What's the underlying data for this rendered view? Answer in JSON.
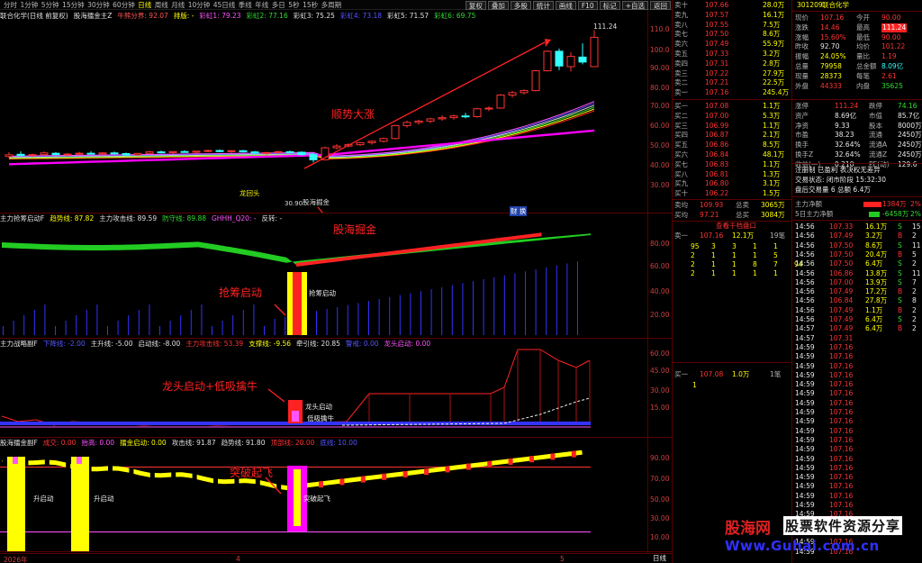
{
  "toolbar": {
    "periods": [
      "分时",
      "1分钟",
      "5分钟",
      "15分钟",
      "30分钟",
      "60分钟",
      "日线",
      "周线",
      "月线",
      "10分钟",
      "45日线",
      "季线",
      "年线",
      "多日",
      "5秒",
      "15秒",
      "多周期"
    ],
    "active_period": "日线",
    "right_buttons": [
      "复权",
      "叠加",
      "多股",
      "统计",
      "画线",
      "F10",
      "标记",
      "+自选",
      "返回"
    ]
  },
  "main_pane": {
    "header": [
      {
        "text": "联合化学(日线 前复权)",
        "color": "#e0e0e0"
      },
      {
        "text": "股海擂金主Z",
        "color": "#e0e0e0"
      },
      {
        "text": "牛熊分界: 92.07",
        "color": "#ff5555"
      },
      {
        "text": "排版: -",
        "color": "#ffff00"
      },
      {
        "text": "彩虹1: 79.23",
        "color": "#ff55ff"
      },
      {
        "text": "彩虹2: 77.16",
        "color": "#33dd33"
      },
      {
        "text": "彩虹3: 75.25",
        "color": "#e0e0e0"
      },
      {
        "text": "彩虹4: 73.18",
        "color": "#5555ff"
      },
      {
        "text": "彩虹5: 71.57",
        "color": "#e0e0e0"
      },
      {
        "text": "彩虹6: 69.75",
        "color": "#33dd33"
      }
    ],
    "axis": [
      "110.0",
      "100.0",
      "90.00",
      "80.00",
      "70.00",
      "60.00",
      "50.00",
      "40.00",
      "30.00"
    ],
    "annotations": {
      "trend": "顺势大涨",
      "gold": "股海掘金",
      "high_label": "111.24",
      "low_label": "30.90",
      "candle_tag": "股海掘金",
      "dragon_tag": "龙回头",
      "bottom_tag": "财 换"
    }
  },
  "pane2": {
    "header": [
      {
        "text": "主力抢筹启动F",
        "color": "#e0e0e0"
      },
      {
        "text": "趋势线: 87.82",
        "color": "#ffff00"
      },
      {
        "text": "主力攻击线: 89.59",
        "color": "#e0e0e0"
      },
      {
        "text": "防守线: 89.88",
        "color": "#33dd33"
      },
      {
        "text": "GHHH_Q20: -",
        "color": "#ff55ff"
      },
      {
        "text": "反转: -",
        "color": "#e0e0e0"
      }
    ],
    "axis": [
      "80.00",
      "60.00",
      "40.00",
      "20.00"
    ],
    "annotations": {
      "label": "抢筹启动",
      "tag": "抢筹启动"
    }
  },
  "pane3": {
    "header": [
      {
        "text": "主力战略副F",
        "color": "#e0e0e0"
      },
      {
        "text": "下降线: -2.00",
        "color": "#5555ff"
      },
      {
        "text": "主升线: -5.00",
        "color": "#e0e0e0"
      },
      {
        "text": "启动线: -8.00",
        "color": "#e0e0e0"
      },
      {
        "text": "主力攻击线: 53.39",
        "color": "#ff3333"
      },
      {
        "text": "支撑线: -9.56",
        "color": "#ffff00"
      },
      {
        "text": "牵引线: 20.85",
        "color": "#e0e0e0"
      },
      {
        "text": "警戒: 0.00",
        "color": "#5555ff"
      },
      {
        "text": "龙头启动: 0.00",
        "color": "#ff55ff"
      }
    ],
    "axis": [
      "60.00",
      "45.00",
      "30.00",
      "15.00"
    ],
    "annotations": {
      "label": "龙头启动+低吸擒牛",
      "tag1": "龙头启动",
      "tag2": "低吸擒牛"
    }
  },
  "pane4": {
    "header": [
      {
        "text": "股海擂金副F",
        "color": "#e0e0e0"
      },
      {
        "text": "成交: 0.00",
        "color": "#ff3333"
      },
      {
        "text": "抬高: 0.00",
        "color": "#ff55ff"
      },
      {
        "text": "擂金启动: 0.00",
        "color": "#ffff00"
      },
      {
        "text": "攻击线: 91.87",
        "color": "#e0e0e0"
      },
      {
        "text": "趋势线: 91.80",
        "color": "#e0e0e0"
      },
      {
        "text": "顶部线: 20.00",
        "color": "#ff3333"
      },
      {
        "text": "底线: 10.00",
        "color": "#5555ff"
      }
    ],
    "axis": [
      "90.00",
      "70.00",
      "50.00",
      "30.00",
      "10.00"
    ],
    "annotations": {
      "label": "突破起飞",
      "tag": "突破起飞",
      "side1": "升启动",
      "side2": "升启动"
    }
  },
  "bottom": {
    "year": "2026年",
    "m1": "4",
    "m2": "5"
  },
  "quote": {
    "code": "301209",
    "name": "联合化学",
    "ask": [
      {
        "label": "卖十",
        "price": "107.66",
        "vol": "28.0万"
      },
      {
        "label": "卖九",
        "price": "107.57",
        "vol": "16.1万"
      },
      {
        "label": "卖八",
        "price": "107.55",
        "vol": "7.5万"
      },
      {
        "label": "卖七",
        "price": "107.50",
        "vol": "8.6万"
      },
      {
        "label": "卖六",
        "price": "107.49",
        "vol": "55.9万"
      },
      {
        "label": "卖五",
        "price": "107.33",
        "vol": "3.2万"
      },
      {
        "label": "卖四",
        "price": "107.31",
        "vol": "2.8万"
      },
      {
        "label": "卖三",
        "price": "107.22",
        "vol": "27.9万"
      },
      {
        "label": "卖二",
        "price": "107.21",
        "vol": "22.5万"
      },
      {
        "label": "卖一",
        "price": "107.16",
        "vol": "245.4万"
      }
    ],
    "stats": [
      {
        "k": "现价",
        "v": "107.16",
        "k2": "今开",
        "v2": "90.00"
      },
      {
        "k": "涨跌",
        "v": "14.46",
        "k2": "最高",
        "v2": "111.24"
      },
      {
        "k": "涨幅",
        "v": "15.60%",
        "k2": "最低",
        "v2": "90.00"
      },
      {
        "k": "昨收",
        "v": "92.70",
        "k2": "均价",
        "v2": "101.22"
      },
      {
        "k": "振幅",
        "v": "24.05%",
        "k2": "量比",
        "v2": "1.19"
      },
      {
        "k": "总量",
        "v": "79958",
        "k2": "总金额",
        "v2": "8.09亿"
      },
      {
        "k": "现量",
        "v": "28373",
        "k2": "每笔",
        "v2": "2.61"
      },
      {
        "k": "外盘",
        "v": "44333",
        "k2": "内盘",
        "v2": "35625"
      }
    ],
    "bid": [
      {
        "label": "买一",
        "price": "107.08",
        "vol": "1.1万"
      },
      {
        "label": "买二",
        "price": "107.00",
        "vol": "5.3万"
      },
      {
        "label": "买三",
        "price": "106.99",
        "vol": "1.1万"
      },
      {
        "label": "买四",
        "price": "106.87",
        "vol": "2.1万"
      },
      {
        "label": "买五",
        "price": "106.86",
        "vol": "8.5万"
      },
      {
        "label": "买六",
        "price": "106.84",
        "vol": "48.1万"
      },
      {
        "label": "买七",
        "price": "106.83",
        "vol": "1.1万"
      },
      {
        "label": "买八",
        "price": "106.81",
        "vol": "1.3万"
      },
      {
        "label": "买九",
        "price": "106.80",
        "vol": "3.1万"
      },
      {
        "label": "买十",
        "price": "106.22",
        "vol": "1.5万"
      }
    ],
    "avg": [
      {
        "k": "卖均",
        "v": "109.93",
        "k2": "总卖",
        "v2": "3065万"
      },
      {
        "k": "买均",
        "v": "97.21",
        "k2": "总买",
        "v2": "3084万"
      }
    ],
    "queue_link": "查看千档盘口",
    "queue_sell": {
      "label": "卖一",
      "price": "107.16",
      "vol": "12.1万",
      "cnt": "19笔"
    },
    "queue_sell_rows": [
      [
        "95",
        "3",
        "3",
        "1",
        "1"
      ],
      [
        "2",
        "1",
        "1",
        "1",
        "5"
      ],
      [
        "2",
        "1",
        "1",
        "8",
        "7",
        "94"
      ],
      [
        "2",
        "1",
        "1",
        "1",
        "1"
      ]
    ],
    "queue_buy": {
      "label": "买一",
      "price": "107.08",
      "vol": "1.0万",
      "cnt": "1笔"
    },
    "queue_buy_rows": [
      [
        "1"
      ]
    ],
    "fund": [
      {
        "k": "涨停",
        "v": "111.24",
        "k2": "跌停",
        "v2": "74.16"
      },
      {
        "k": "资产",
        "v": "8.69亿",
        "k2": "市值",
        "v2": "85.7亿"
      },
      {
        "k": "净资",
        "v": "9.33",
        "k2": "股本",
        "v2": "8000万"
      },
      {
        "k": "市盈",
        "v": "38.23",
        "k2": "流通",
        "v2": "2450万"
      },
      {
        "k": "换手",
        "v": "32.64%",
        "k2": "流通A",
        "v2": "2450万"
      },
      {
        "k": "换手Z",
        "v": "32.64%",
        "k2": "流通Z",
        "v2": "2450万"
      },
      {
        "k": "收益(一)",
        "v": "0.210",
        "k2": "PE(动)",
        "v2": "129.6"
      }
    ],
    "info1": "注册制 已盈利 表决权无差异",
    "info2": "交易状态: 闭市阶段 15:32:30",
    "info3": "盘后交易量 6 总额 6.4万",
    "net": [
      {
        "k": "主力净额",
        "v": "1384万",
        "pct": "2%"
      },
      {
        "k": "5日主力净额",
        "v": "-6458万",
        "pct": "2%"
      }
    ],
    "ticks": [
      [
        "14:56",
        "107.33",
        "16.1万",
        "S",
        "15"
      ],
      [
        "14:56",
        "107.49",
        "3.2万",
        "B",
        "2"
      ],
      [
        "14:56",
        "107.50",
        "8.6万",
        "S",
        "11"
      ],
      [
        "14:56",
        "107.50",
        "20.4万",
        "B",
        "5"
      ],
      [
        "14:56",
        "107.50",
        "6.4万",
        "S",
        "2"
      ],
      [
        "14:56",
        "106.86",
        "13.8万",
        "S",
        "11"
      ],
      [
        "14:56",
        "107.00",
        "13.9万",
        "S",
        "7"
      ],
      [
        "14:56",
        "107.49",
        "17.2万",
        "B",
        "2"
      ],
      [
        "14:56",
        "106.84",
        "27.8万",
        "S",
        "8"
      ],
      [
        "14:56",
        "107.49",
        "1.1万",
        "B",
        "2"
      ],
      [
        "14:56",
        "107.49",
        "6.4万",
        "S",
        "2"
      ],
      [
        "14:57",
        "107.49",
        "6.4万",
        "B",
        "2"
      ],
      [
        "14:57",
        "107.31",
        "",
        ""
      ],
      [
        "14:59",
        "107.16",
        "",
        ""
      ],
      [
        "14:59",
        "107.16",
        "",
        ""
      ],
      [
        "14:59",
        "107.16",
        "",
        ""
      ],
      [
        "14:59",
        "107.16",
        "",
        ""
      ],
      [
        "14:59",
        "107.16",
        "",
        ""
      ],
      [
        "14:59",
        "107.16",
        "",
        ""
      ],
      [
        "14:59",
        "107.16",
        "",
        ""
      ],
      [
        "14:59",
        "107.16",
        "",
        ""
      ],
      [
        "14:59",
        "107.16",
        "",
        ""
      ],
      [
        "14:59",
        "107.16",
        "",
        ""
      ],
      [
        "14:59",
        "107.16",
        "",
        ""
      ],
      [
        "14:59",
        "107.16",
        "",
        ""
      ],
      [
        "14:59",
        "107.16",
        "",
        ""
      ],
      [
        "14:59",
        "107.16",
        "",
        ""
      ],
      [
        "14:59",
        "107.16",
        "",
        ""
      ],
      [
        "14:59",
        "107.16",
        "",
        ""
      ],
      [
        "14:59",
        "107.16",
        "",
        ""
      ],
      [
        "14:59",
        "107.16",
        "",
        ""
      ],
      [
        "14:59",
        "107.16",
        "",
        ""
      ],
      [
        "14:59",
        "107.16",
        "",
        ""
      ],
      [
        "14:59",
        "107.16",
        "",
        ""
      ],
      [
        "14:59",
        "107.16",
        "",
        ""
      ],
      [
        "14:59",
        "107.16",
        "",
        ""
      ],
      [
        "14:59",
        "107.16",
        "",
        ""
      ]
    ],
    "bottom_tab": "日线"
  },
  "watermark": {
    "brand": "股海网",
    "tag": "股票软件资源分享",
    "url": "Www.Guhai.com.cn"
  },
  "chart_data": {
    "type": "candlestick",
    "price_series": [
      {
        "o": 37.5,
        "h": 40.0,
        "l": 36.6,
        "c": 38.5
      },
      {
        "o": 38.8,
        "h": 40.5,
        "l": 37.8,
        "c": 38.0
      },
      {
        "o": 38.1,
        "h": 39.2,
        "l": 37.2,
        "c": 38.6
      },
      {
        "o": 38.6,
        "h": 40.4,
        "l": 37.8,
        "c": 39.6
      },
      {
        "o": 39.4,
        "h": 40.1,
        "l": 38.2,
        "c": 38.6
      },
      {
        "o": 38.4,
        "h": 39.6,
        "l": 37.4,
        "c": 38.9
      },
      {
        "o": 39.0,
        "h": 40.2,
        "l": 38.0,
        "c": 39.4
      },
      {
        "o": 39.4,
        "h": 40.6,
        "l": 38.7,
        "c": 39.0
      },
      {
        "o": 39.0,
        "h": 40.0,
        "l": 38.0,
        "c": 39.6
      },
      {
        "o": 39.6,
        "h": 40.4,
        "l": 38.8,
        "c": 39.2
      },
      {
        "o": 39.2,
        "h": 39.8,
        "l": 38.0,
        "c": 38.4
      },
      {
        "o": 38.5,
        "h": 39.6,
        "l": 37.8,
        "c": 39.3
      },
      {
        "o": 39.3,
        "h": 40.8,
        "l": 38.6,
        "c": 40.2
      },
      {
        "o": 40.2,
        "h": 41.0,
        "l": 39.4,
        "c": 39.8
      },
      {
        "o": 39.8,
        "h": 40.6,
        "l": 39.0,
        "c": 40.4
      },
      {
        "o": 40.4,
        "h": 41.2,
        "l": 39.8,
        "c": 40.0
      },
      {
        "o": 40.0,
        "h": 40.8,
        "l": 39.2,
        "c": 40.6
      },
      {
        "o": 40.6,
        "h": 41.5,
        "l": 40.0,
        "c": 41.0
      },
      {
        "o": 41.0,
        "h": 41.6,
        "l": 40.0,
        "c": 40.4
      },
      {
        "o": 40.4,
        "h": 41.2,
        "l": 39.6,
        "c": 40.9
      },
      {
        "o": 40.9,
        "h": 41.4,
        "l": 39.9,
        "c": 40.2
      },
      {
        "o": 40.2,
        "h": 40.8,
        "l": 39.0,
        "c": 39.4
      },
      {
        "o": 39.4,
        "h": 40.2,
        "l": 38.4,
        "c": 39.8
      },
      {
        "o": 39.8,
        "h": 40.8,
        "l": 39.2,
        "c": 40.3
      },
      {
        "o": 40.3,
        "h": 41.0,
        "l": 39.6,
        "c": 40.0
      },
      {
        "o": 40.0,
        "h": 40.5,
        "l": 38.0,
        "c": 38.6
      },
      {
        "o": 38.6,
        "h": 39.4,
        "l": 34.0,
        "c": 35.6
      },
      {
        "o": 35.6,
        "h": 43.2,
        "l": 35.2,
        "c": 42.6
      },
      {
        "o": 42.6,
        "h": 44.8,
        "l": 41.6,
        "c": 43.6
      },
      {
        "o": 43.6,
        "h": 45.2,
        "l": 42.8,
        "c": 44.4
      },
      {
        "o": 44.4,
        "h": 46.0,
        "l": 43.6,
        "c": 45.6
      },
      {
        "o": 45.6,
        "h": 47.0,
        "l": 44.4,
        "c": 46.4
      },
      {
        "o": 46.4,
        "h": 48.6,
        "l": 45.6,
        "c": 48.0
      },
      {
        "o": 48.0,
        "h": 56.0,
        "l": 47.5,
        "c": 55.6
      },
      {
        "o": 55.6,
        "h": 58.4,
        "l": 54.4,
        "c": 57.4
      },
      {
        "o": 57.4,
        "h": 59.0,
        "l": 56.2,
        "c": 58.2
      },
      {
        "o": 58.2,
        "h": 60.2,
        "l": 57.0,
        "c": 59.5
      },
      {
        "o": 59.5,
        "h": 61.6,
        "l": 58.4,
        "c": 60.2
      },
      {
        "o": 60.2,
        "h": 62.0,
        "l": 59.0,
        "c": 61.2
      },
      {
        "o": 61.2,
        "h": 63.0,
        "l": 59.8,
        "c": 60.8
      },
      {
        "o": 60.8,
        "h": 66.0,
        "l": 60.2,
        "c": 65.4
      },
      {
        "o": 65.4,
        "h": 66.8,
        "l": 64.0,
        "c": 65.8
      },
      {
        "o": 65.8,
        "h": 74.0,
        "l": 65.4,
        "c": 73.4
      },
      {
        "o": 73.4,
        "h": 75.8,
        "l": 72.0,
        "c": 74.8
      },
      {
        "o": 74.8,
        "h": 76.8,
        "l": 73.6,
        "c": 76.0
      },
      {
        "o": 76.0,
        "h": 88.0,
        "l": 75.6,
        "c": 87.6
      },
      {
        "o": 87.6,
        "h": 99.4,
        "l": 87.2,
        "c": 99.0
      },
      {
        "o": 99.0,
        "h": 100.6,
        "l": 88.0,
        "c": 90.4
      },
      {
        "o": 90.0,
        "h": 98.4,
        "l": 87.2,
        "c": 96.0
      },
      {
        "o": 95.6,
        "h": 103.6,
        "l": 91.4,
        "c": 92.7
      },
      {
        "o": 90.0,
        "h": 111.24,
        "l": 90.0,
        "c": 107.16
      }
    ],
    "pane2_bars": [
      4,
      6,
      8,
      10,
      12,
      14,
      16,
      18,
      20,
      22,
      14,
      10,
      12,
      8,
      6,
      5,
      6,
      12,
      18,
      22,
      28,
      34,
      40,
      44,
      40,
      36,
      32,
      30,
      28,
      30,
      34,
      38,
      42,
      46,
      48,
      50,
      52,
      54,
      56,
      58,
      60,
      62,
      64,
      66,
      68,
      70,
      72,
      74,
      76,
      78,
      80
    ]
  }
}
